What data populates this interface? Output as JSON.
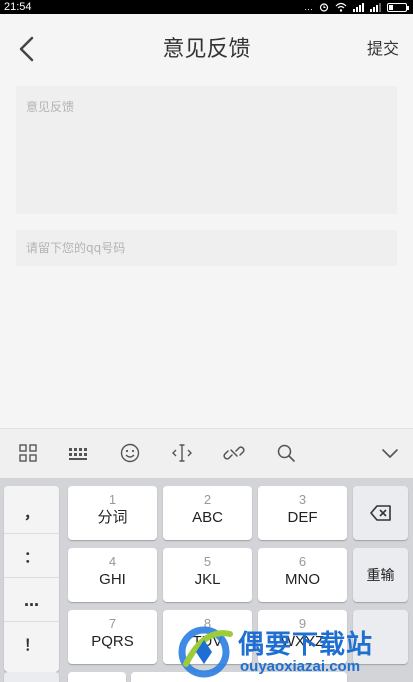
{
  "status_bar": {
    "time": "21:54",
    "more": "…"
  },
  "header": {
    "title": "意见反馈",
    "submit_label": "提交"
  },
  "form": {
    "feedback_placeholder": "意见反馈",
    "qq_placeholder": "请留下您的qq号码"
  },
  "keyboard": {
    "toolbar_icons": [
      "grid-icon",
      "keyboard-layout-icon",
      "emoji-icon",
      "cursor-icon",
      "link-icon",
      "search-icon",
      "collapse-keyboard-icon"
    ],
    "side_keys": [
      "，",
      "：",
      "…",
      "！"
    ],
    "keys": [
      {
        "num": "1",
        "label": "分词"
      },
      {
        "num": "2",
        "label": "ABC"
      },
      {
        "num": "3",
        "label": "DEF"
      },
      {
        "num": "4",
        "label": "GHI"
      },
      {
        "num": "5",
        "label": "JKL"
      },
      {
        "num": "6",
        "label": "MNO"
      },
      {
        "num": "7",
        "label": "PQRS"
      },
      {
        "num": "8",
        "label": "TUV"
      },
      {
        "num": "9",
        "label": "WXYZ"
      }
    ],
    "backspace_icon": "backspace-icon",
    "reenter_label": "重输"
  },
  "watermark": {
    "brand": "偶要下载站",
    "url": "ouyaoxiazai.com"
  },
  "colors": {
    "background": "#f5f5f5",
    "input_bg": "#efefef",
    "keyboard_bg": "#d3d4d8",
    "watermark": "#1e6fd1"
  }
}
